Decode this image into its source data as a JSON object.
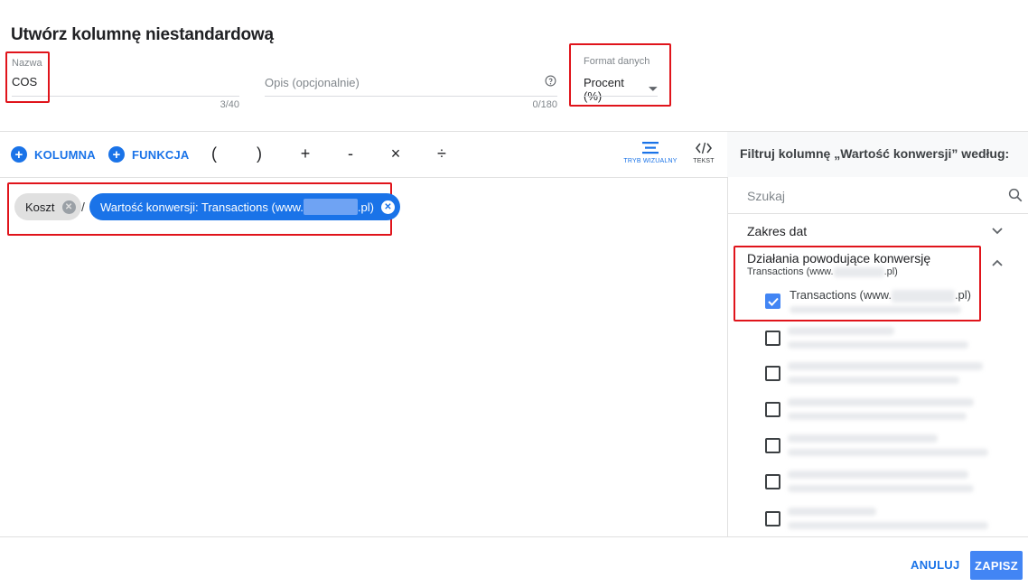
{
  "dialog": {
    "title": "Utwórz kolumnę niestandardową"
  },
  "name_field": {
    "label": "Nazwa",
    "value": "COS",
    "counter": "3/40"
  },
  "description_field": {
    "placeholder": "Opis (opcjonalnie)",
    "counter": "0/180"
  },
  "format_field": {
    "label": "Format danych",
    "value": "Procent (%)"
  },
  "toolbar": {
    "column_label": "KOLUMNA",
    "function_label": "FUNKCJA",
    "operators": [
      "(",
      ")",
      "+",
      "-",
      "×",
      "÷"
    ],
    "visual_mode_label": "TRYB WIZUALNY",
    "text_mode_label": "TEKST"
  },
  "formula": {
    "chip1": "Koszt",
    "separator": "/",
    "chip2_prefix": "Wartość konwersji: Transactions (www.",
    "chip2_suffix": ".pl)"
  },
  "panel": {
    "title": "Filtruj kolumnę „Wartość konwersji” według:",
    "search_placeholder": "Szukaj",
    "date_range_label": "Zakres dat",
    "conversion_actions_label": "Działania powodujące konwersję",
    "conversion_actions_sub_prefix": "Transactions (www.",
    "conversion_actions_sub_suffix": ".pl)",
    "item_prefix": "Transactions (www.",
    "item_suffix": ".pl)"
  },
  "footer": {
    "cancel_label": "ANULUJ",
    "save_label": "ZAPISZ"
  },
  "colors": {
    "accent": "#1a73e8",
    "highlight_border": "#e0141b",
    "checkbox": "#4285f4"
  }
}
